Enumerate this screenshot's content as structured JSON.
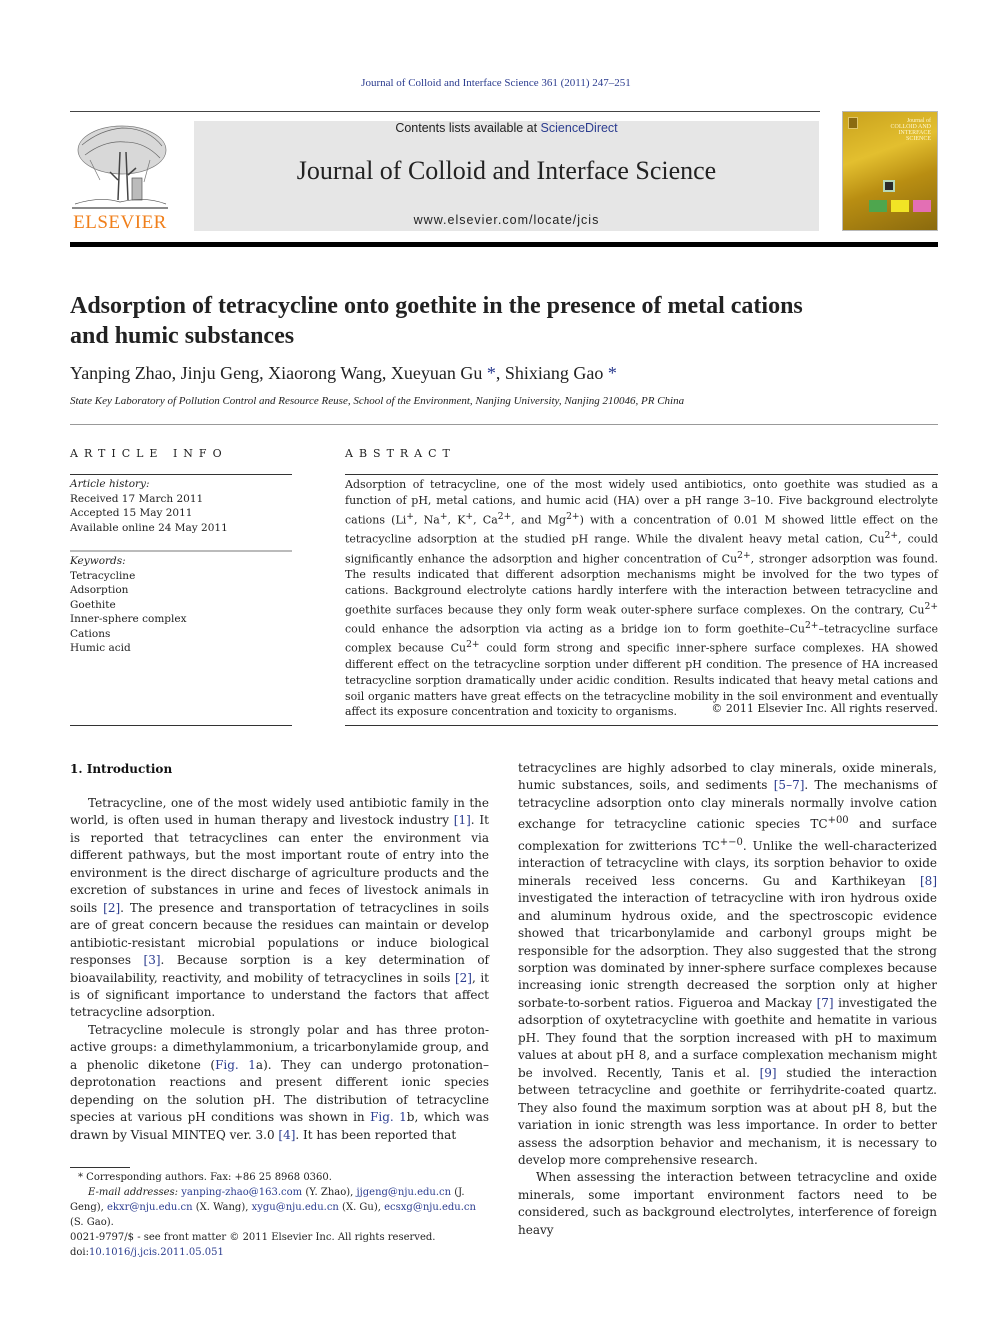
{
  "running_head": "Journal of Colloid and Interface Science 361 (2011) 247–251",
  "banner": {
    "contents_prefix": "Contents lists available at ",
    "contents_link": "ScienceDirect",
    "journal_name": "Journal of Colloid and Interface Science",
    "journal_url": "www.elsevier.com/locate/jcis"
  },
  "publisher_logo": {
    "wordmark": "ELSEVIER",
    "color": "#f07f1b"
  },
  "cover": {
    "title_lines": [
      "Journal of",
      "COLLOID AND",
      "INTERFACE",
      "SCIENCE"
    ]
  },
  "article": {
    "title_line1": "Adsorption of tetracycline onto goethite in the presence of metal cations",
    "title_line2": "and humic substances",
    "authors": [
      {
        "name": "Yanping Zhao",
        "corresponding": false
      },
      {
        "name": "Jinju Geng",
        "corresponding": false
      },
      {
        "name": "Xiaorong Wang",
        "corresponding": false
      },
      {
        "name": "Xueyuan Gu",
        "corresponding": true
      },
      {
        "name": "Shixiang Gao",
        "corresponding": true
      }
    ],
    "author_a1": "Yanping Zhao, ",
    "author_a2": "Jinju Geng, ",
    "author_a3": "Xiaorong Wang, ",
    "author_a4": "Xueyuan Gu",
    "author_a5": "Shixiang Gao",
    "corresponding_mark": "*",
    "affiliation": "State Key Laboratory of Pollution Control and Resource Reuse, School of the Environment, Nanjing University, Nanjing 210046, PR China"
  },
  "article_info": {
    "heading": "ARTICLE INFO",
    "history_label": "Article history:",
    "received": "Received 17 March 2011",
    "accepted": "Accepted 15 May 2011",
    "online": "Available online 24 May 2011",
    "keywords_label": "Keywords:",
    "keywords": [
      "Tetracycline",
      "Adsorption",
      "Goethite",
      "Inner-sphere complex",
      "Cations",
      "Humic acid"
    ]
  },
  "abstract": {
    "heading": "ABSTRACT",
    "p1": "Adsorption of tetracycline, one of the most widely used antibiotics, onto goethite was studied as a function of pH, metal cations, and humic acid (HA) over a pH range 3–10. Five background electrolyte cations (Li",
    "p2": ", Na",
    "p3": ", K",
    "p4": ", Ca",
    "p5": ", and Mg",
    "p6": ") with a concentration of 0.01 M showed little effect on the tetracycline adsorption at the studied pH range. While the divalent heavy metal cation, Cu",
    "p7": ", could significantly enhance the adsorption and higher concentration of Cu",
    "p8": ", stronger adsorption was found. The results indicated that different adsorption mechanisms might be involved for the two types of cations. Background electrolyte cations hardly interfere with the interaction between tetracycline and goethite surfaces because they only form weak outer-sphere surface complexes. On the contrary, Cu",
    "p9": " could enhance the adsorption via acting as a bridge ion to form goethite–Cu",
    "p10": "–tetracycline surface complex because Cu",
    "p11": " could form strong and specific inner-sphere surface complexes. HA showed different effect on the tetracycline sorption under different pH condition. The presence of HA increased tetracycline sorption dramatically under acidic condition. Results indicated that heavy metal cations and soil organic matters have great effects on the tetracycline mobility in the soil environment and eventually affect its exposure concentration and toxicity to organisms.",
    "sup_plus": "+",
    "sup_2plus": "2+",
    "copyright": "© 2011 Elsevier Inc. All rights reserved."
  },
  "introduction": {
    "heading": "1. Introduction",
    "left": {
      "a1": "Tetracycline, one of the most widely used antibiotic family in the world, is often used in human therapy and livestock industry ",
      "ref1": "[1]",
      "a2": ". It is reported that tetracyclines can enter the environment via different pathways, but the most important route of entry into the environment is the direct discharge of agriculture products and the excretion of substances in urine and feces of livestock animals in soils ",
      "ref2": "[2]",
      "a3": ". The presence and transportation of tetracyclines in soils are of great concern because the residues can maintain or develop antibiotic-resistant microbial populations or induce biological responses ",
      "ref3": "[3]",
      "a4": ". Because sorption is a key determination of bioavailability, reactivity, and mobility of tetracyclines in soils ",
      "ref4": "[2]",
      "a5": ", it is of significant importance to understand the factors that affect tetracycline adsorption.",
      "b1": "Tetracycline molecule is strongly polar and has three proton-active groups: a dimethylammonium, a tricarbonylamide group, and a phenolic diketone (",
      "fig1": "Fig. 1",
      "b2": "a). They can undergo protonation–deprotonation reactions and present different ionic species depending on the solution pH. The distribution of tetracycline species at various pH conditions was shown in ",
      "fig2": "Fig. 1",
      "b3": "b, which was drawn by Visual MINTEQ ver. 3.0 ",
      "ref5": "[4]",
      "b4": ". It has been reported that"
    },
    "right": {
      "c1": "tetracyclines are highly adsorbed to clay minerals, oxide minerals, humic substances, soils, and sediments ",
      "ref1": "[5–7]",
      "c2": ". The mechanisms of tetracycline adsorption onto clay minerals normally involve cation exchange for tetracycline cationic species TC",
      "sup1": "+00",
      "c3": " and surface complexation for zwitterions TC",
      "sup2": "+−0",
      "c4": ". Unlike the well-characterized interaction of tetracycline with clays, its sorption behavior to oxide minerals received less concerns. Gu and Karthikeyan ",
      "ref2": "[8]",
      "c5": " investigated the interaction of tetracycline with iron hydrous oxide and aluminum hydrous oxide, and the spectroscopic evidence showed that tricarbonylamide and carbonyl groups might be responsible for the adsorption. They also suggested that the strong sorption was dominated by inner-sphere surface complexes because increasing ionic strength decreased the sorption only at higher sorbate-to-sorbent ratios. Figueroa and Mackay ",
      "ref3": "[7]",
      "c6": " investigated the adsorption of oxytetracycline with goethite and hematite in various pH. They found that the sorption increased with pH to maximum values at about pH 8, and a surface complexation mechanism might be involved. Recently, Tanis et al. ",
      "ref4": "[9]",
      "c7": " studied the interaction between tetracycline and goethite or ferrihydrite-coated quartz. They also found the maximum sorption was at about pH 8, but the variation in ionic strength was less importance. In order to better assess the adsorption behavior and mechanism, it is necessary to develop more comprehensive research.",
      "d1": "When assessing the interaction between tetracycline and oxide minerals, some important environment factors need to be considered, such as background electrolytes, interference of foreign heavy"
    }
  },
  "footnotes": {
    "star": "*",
    "corresponding": " Corresponding authors. Fax: +86 25 8968 0360.",
    "email_label": "E-mail addresses: ",
    "emails": [
      {
        "address": "yanping-zhao@163.com",
        "who": " (Y. Zhao), "
      },
      {
        "address": "jjgeng@nju.edu.cn",
        "who": " (J. Geng), "
      },
      {
        "address": "ekxr@nju.edu.cn",
        "who": " (X. Wang), "
      },
      {
        "address": "xygu@nju.edu.cn",
        "who": " (X. Gu), "
      },
      {
        "address": "ecsxg@nju.edu.cn",
        "who": " (S. Gao)."
      }
    ],
    "front_matter": "0021-9797/$ - see front matter © 2011 Elsevier Inc. All rights reserved.",
    "doi_prefix": "doi:",
    "doi": "10.1016/j.jcis.2011.05.051"
  }
}
